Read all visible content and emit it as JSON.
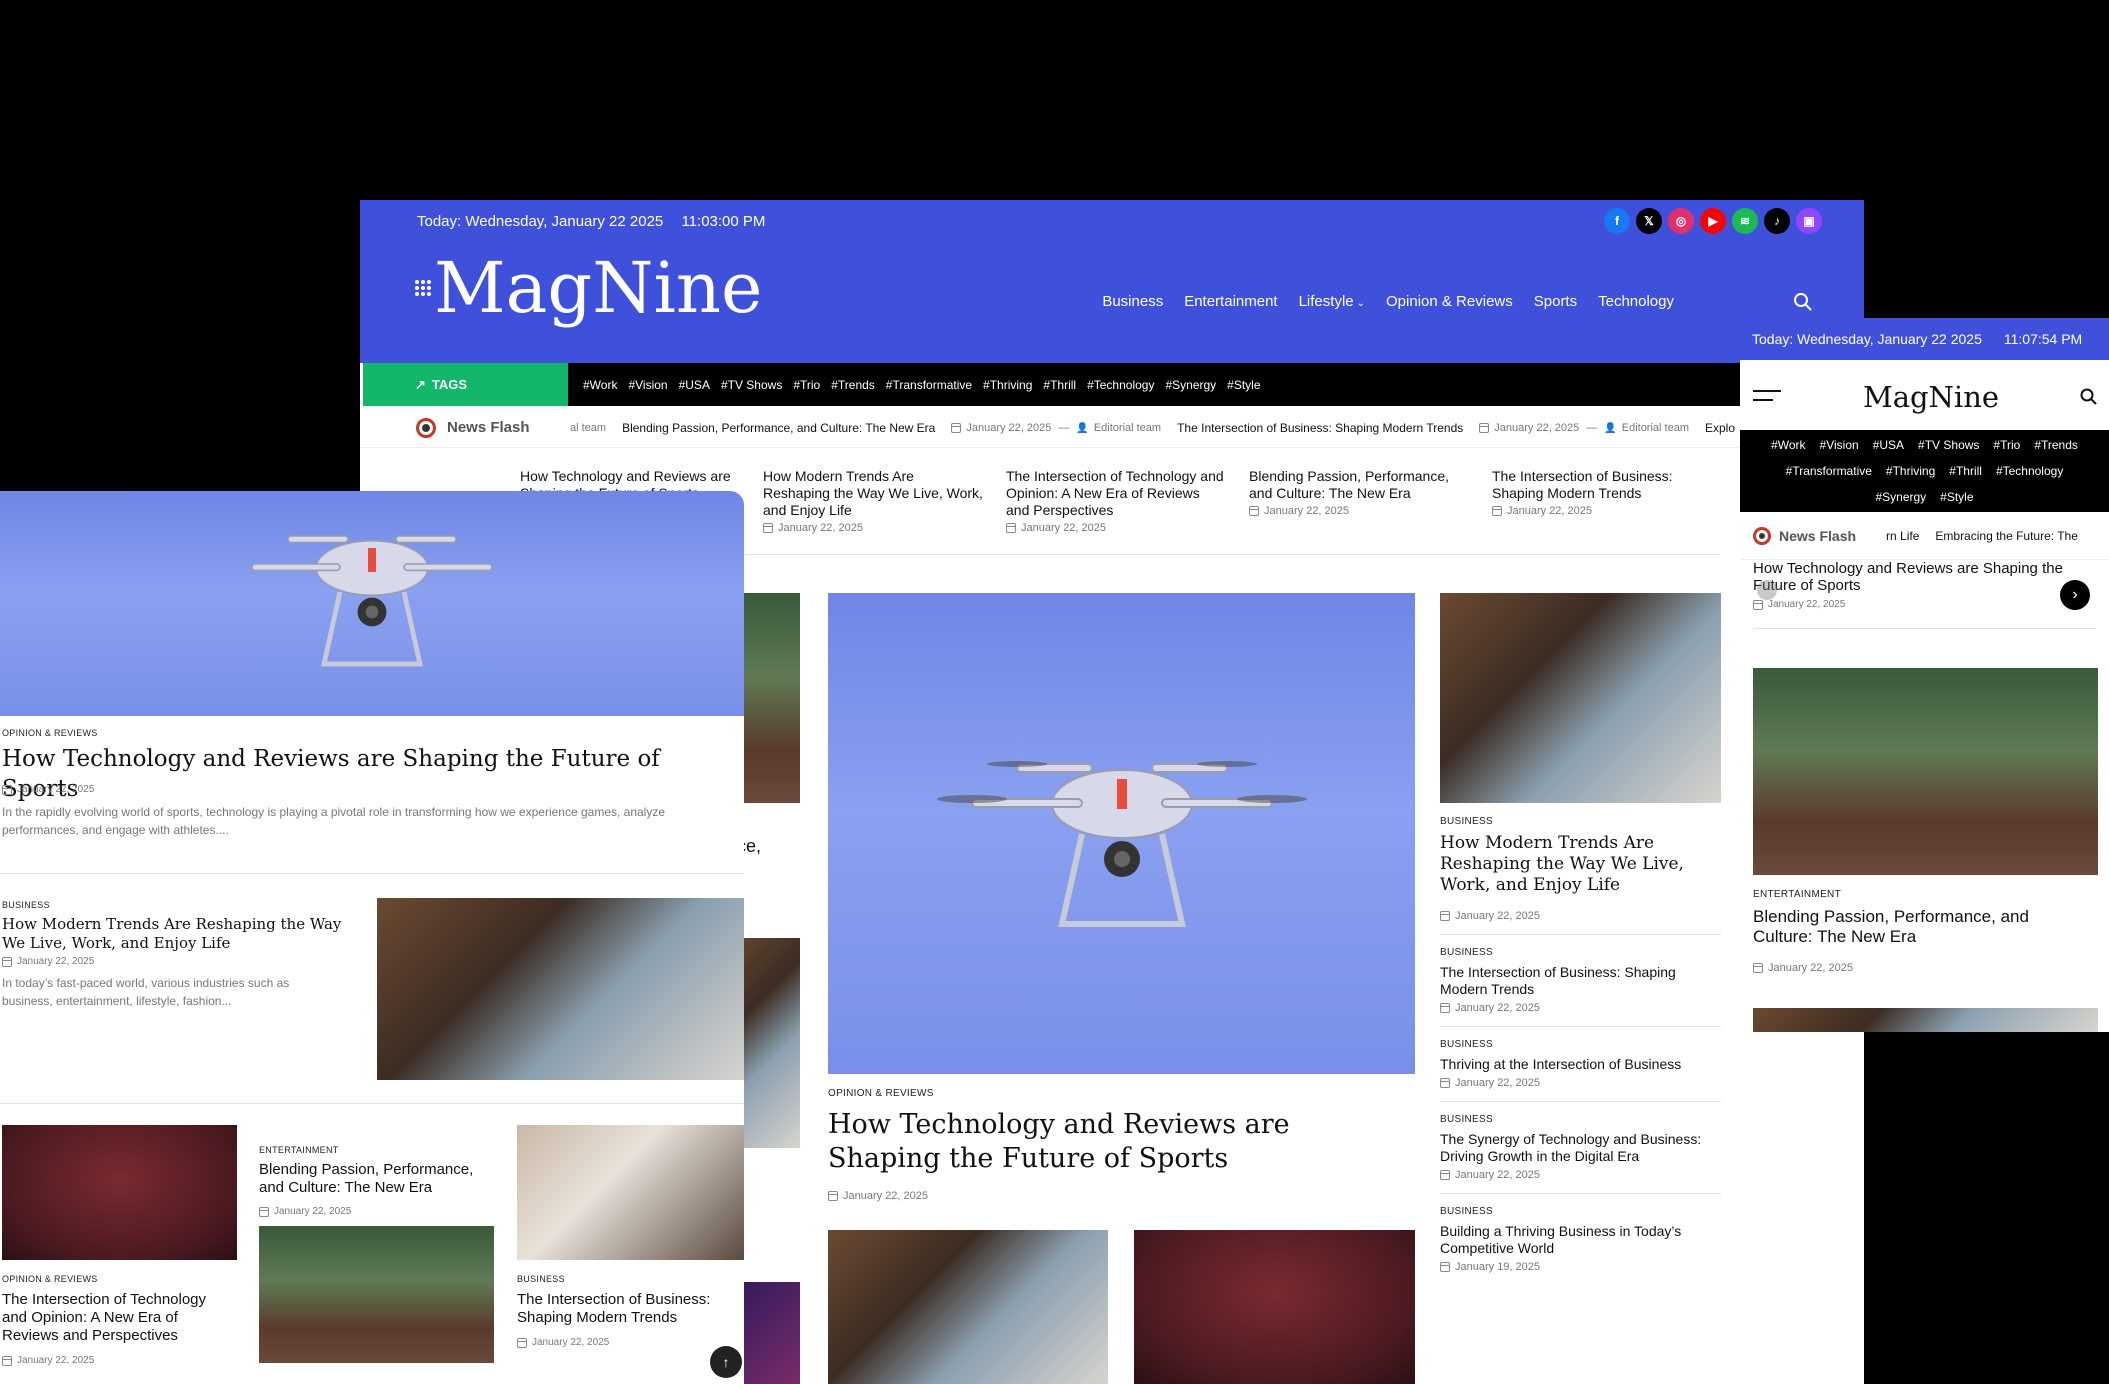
{
  "desktop": {
    "topbar": {
      "date": "Today: Wednesday, January 22 2025",
      "time": "11:03:00 PM"
    },
    "social": [
      {
        "icon": "facebook-icon",
        "glyph": "f",
        "color": "#1877f2"
      },
      {
        "icon": "x-icon",
        "glyph": "𝕏",
        "color": "#000000"
      },
      {
        "icon": "instagram-icon",
        "glyph": "◎",
        "color": "#e1306c"
      },
      {
        "icon": "youtube-icon",
        "glyph": "▶",
        "color": "#ff0000"
      },
      {
        "icon": "spotify-icon",
        "glyph": "≋",
        "color": "#1db954"
      },
      {
        "icon": "tiktok-icon",
        "glyph": "♪",
        "color": "#000000"
      },
      {
        "icon": "twitch-icon",
        "glyph": "▣",
        "color": "#9146ff"
      }
    ],
    "logo": "MagNine",
    "nav": [
      "Business",
      "Entertainment",
      "Lifestyle",
      "Opinion & Reviews",
      "Sports",
      "Technology"
    ],
    "tags_label": "TAGS",
    "tags": [
      "#Work",
      "#Vision",
      "#USA",
      "#TV Shows",
      "#Trio",
      "#Trends",
      "#Transformative",
      "#Thriving",
      "#Thrill",
      "#Technology",
      "#Synergy",
      "#Style"
    ],
    "newsflash": {
      "label": "News Flash",
      "prefix": "al team",
      "items": [
        {
          "title": "Blending Passion, Performance, and Culture: The New Era",
          "date": "January 22, 2025",
          "author": "Editorial team"
        },
        {
          "title": "The Intersection of Business: Shaping Modern Trends",
          "date": "January 22, 2025",
          "author": "Editorial team"
        }
      ],
      "trail": "Explo"
    },
    "carousel": [
      {
        "title": "How Technology and Reviews are Shaping the Future of Sports",
        "date": ""
      },
      {
        "title": "How Modern Trends Are Reshaping the Way We Live, Work, and Enjoy Life",
        "date": "January 22, 2025"
      },
      {
        "title": "The Intersection of Technology and Opinion: A New Era of Reviews and Perspectives",
        "date": "January 22, 2025"
      },
      {
        "title": "Blending Passion, Performance, and Culture: The New Era",
        "date": "January 22, 2025"
      },
      {
        "title": "The Intersection of Business: Shaping Modern Trends",
        "date": "January 22, 2025"
      }
    ],
    "featured": {
      "category": "OPINION & REVIEWS",
      "title": "How Technology and Reviews are Shaping the Future of Sports",
      "date": "January 22, 2025"
    },
    "partial_left": {
      "text1": "nce,",
      "text2": "s:"
    },
    "sidebar": [
      {
        "category": "BUSINESS",
        "title": "How Modern Trends Are Reshaping the Way We Live, Work, and Enjoy Life",
        "date": "January 22, 2025"
      },
      {
        "category": "BUSINESS",
        "title": "The Intersection of Business: Shaping Modern Trends",
        "date": "January 22, 2025"
      },
      {
        "category": "BUSINESS",
        "title": "Thriving at the Intersection of Business",
        "date": "January 22, 2025"
      },
      {
        "category": "BUSINESS",
        "title": "The Synergy of Technology and Business: Driving Growth in the Digital Era",
        "date": "January 22, 2025"
      },
      {
        "category": "BUSINESS",
        "title": "Building a Thriving Business in Today’s Competitive World",
        "date": "January 19, 2025"
      }
    ]
  },
  "tablet": {
    "hero": {
      "category": "OPINION & REVIEWS",
      "title": "How Technology and Reviews are Shaping the Future of Sports",
      "date": "January 22, 2025",
      "excerpt": "In the rapidly evolving world of sports, technology is playing a pivotal role in transforming how we experience games, analyze performances, and engage with athletes...."
    },
    "second": {
      "category": "BUSINESS",
      "title": "How Modern Trends Are Reshaping the Way We Live, Work, and Enjoy Life",
      "date": "January 22, 2025",
      "excerpt": "In today’s fast-paced world, various industries such as business, entertainment, lifestyle, fashion..."
    },
    "grid": [
      {
        "category": "OPINION & REVIEWS",
        "title": "The Intersection of Technology and Opinion: A New Era of Reviews and Perspectives",
        "date": "January 22, 2025"
      },
      {
        "category": "ENTERTAINMENT",
        "title": "Blending Passion, Performance, and Culture: The New Era",
        "date": "January 22, 2025"
      },
      {
        "category": "BUSINESS",
        "title": "The Intersection of Business: Shaping Modern Trends",
        "date": "January 22, 2025"
      }
    ],
    "scroll_top": "↑"
  },
  "mobile": {
    "topbar": {
      "date": "Today: Wednesday, January 22 2025",
      "time": "11:07:54 PM"
    },
    "logo": "MagNine",
    "tags": [
      "#Work",
      "#Vision",
      "#USA",
      "#TV Shows",
      "#Trio",
      "#Trends",
      "#Transformative",
      "#Thriving",
      "#Thrill",
      "#Technology",
      "#Synergy",
      "#Style"
    ],
    "newsflash": {
      "label": "News Flash",
      "text1": "rn Life",
      "text2": "Embracing the Future: The"
    },
    "slide": {
      "title": "How Technology and Reviews are Shaping the Future of Sports",
      "date": "January 22, 2025"
    },
    "card": {
      "category": "ENTERTAINMENT",
      "title": "Blending Passion, Performance, and Culture: The New Era",
      "date": "January 22, 2025"
    }
  },
  "colors": {
    "brand": "#3f51db",
    "tags_green": "#12b76a"
  }
}
